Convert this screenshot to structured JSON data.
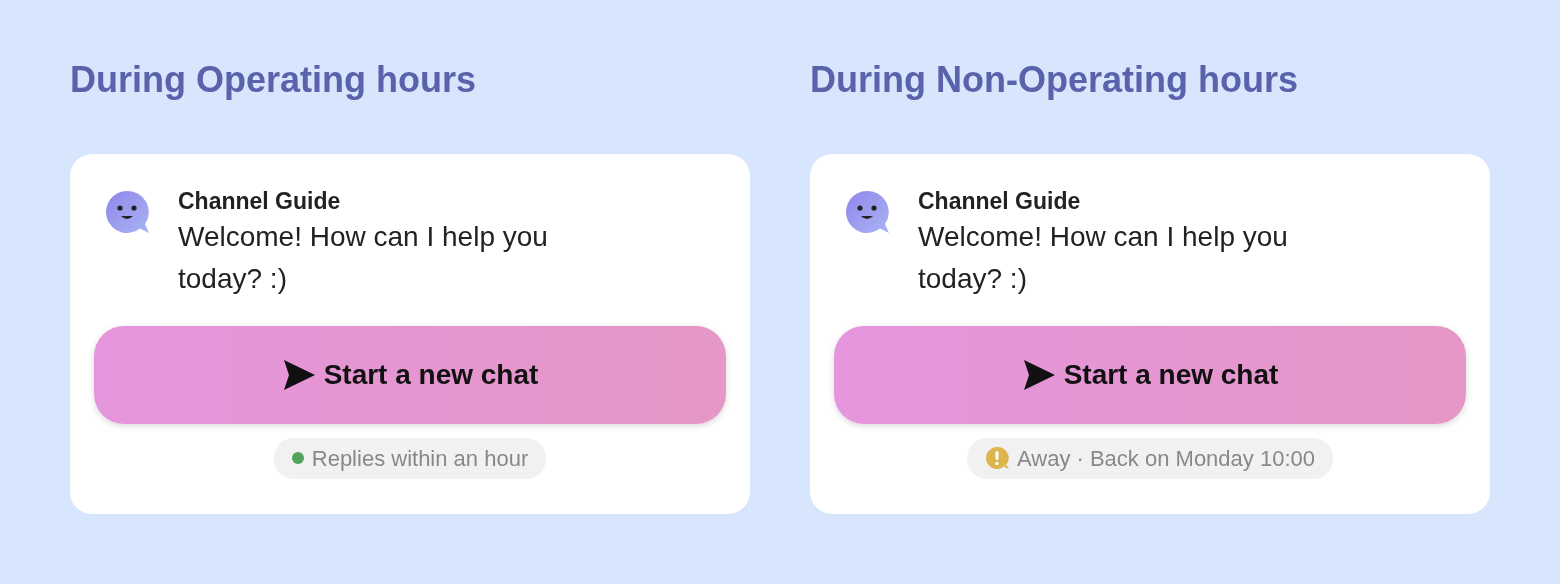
{
  "panels": [
    {
      "heading": "During Operating hours",
      "sender": "Channel Guide",
      "message": "Welcome! How can I help you today? :)",
      "button": "Start a new chat",
      "status": {
        "kind": "online",
        "text": "Replies within an hour"
      }
    },
    {
      "heading": "During Non-Operating hours",
      "sender": "Channel Guide",
      "message": "Welcome! How can I help you today? :)",
      "button": "Start a new chat",
      "status": {
        "kind": "away",
        "text": "Away · Back on Monday 10:00"
      }
    }
  ]
}
